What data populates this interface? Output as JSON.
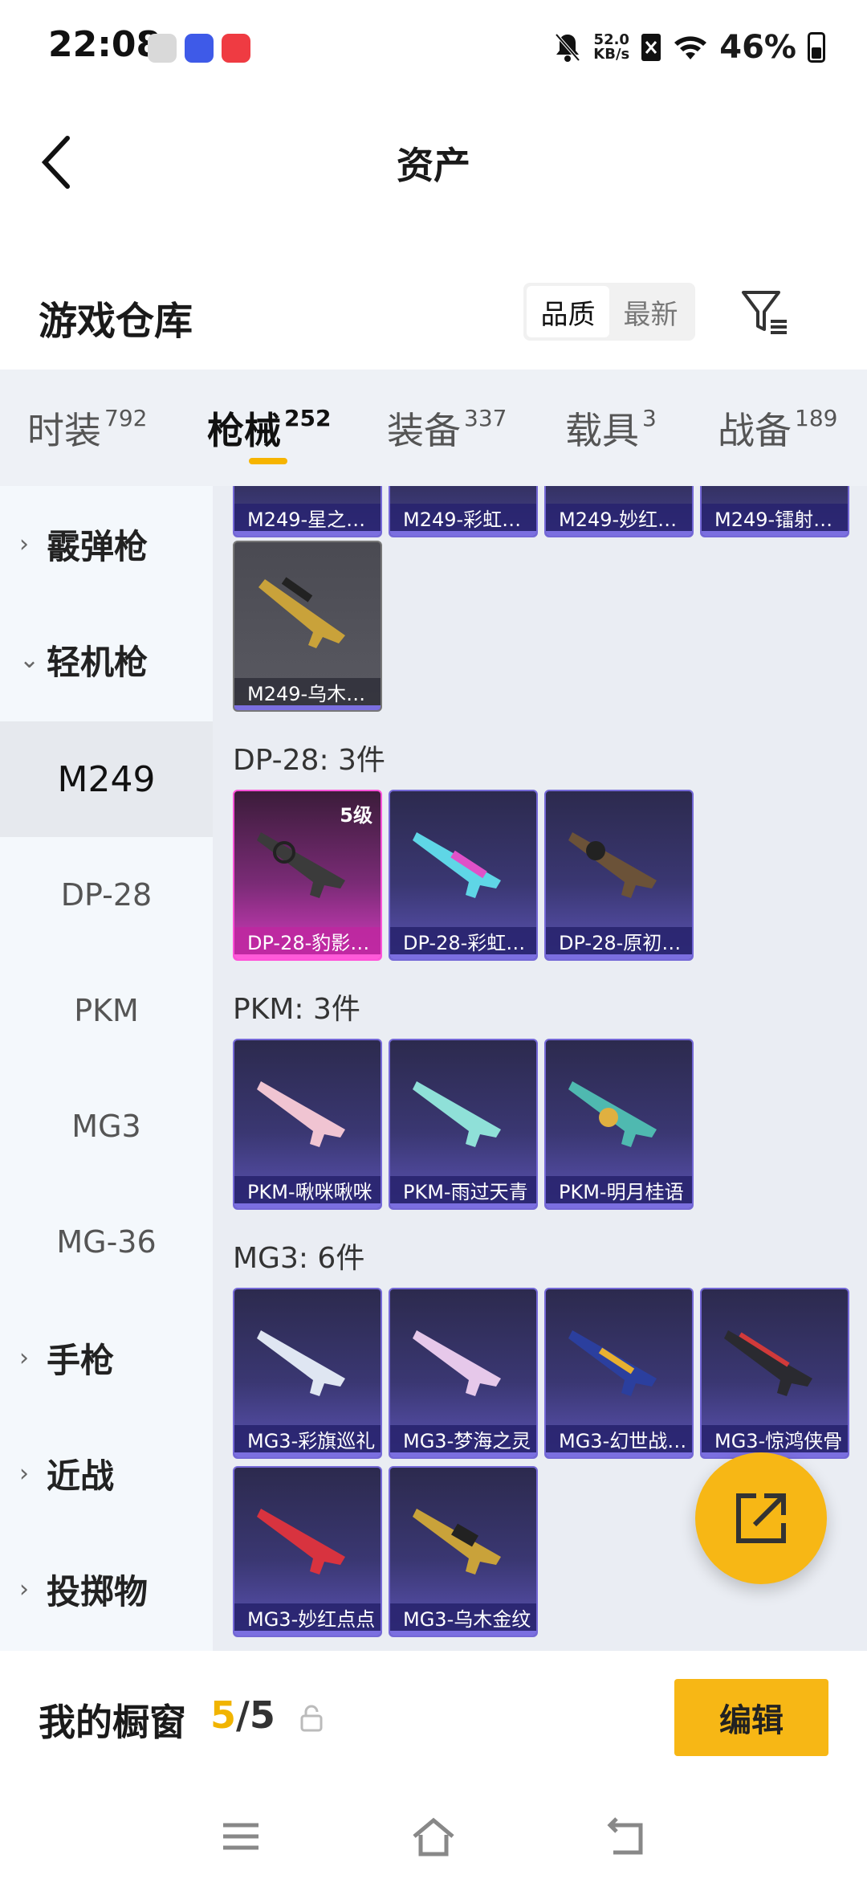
{
  "status": {
    "time": "22:08",
    "netspeed_top": "52.0",
    "netspeed_bottom": "KB/s",
    "battery": "46%"
  },
  "nav": {
    "title": "资产"
  },
  "warehouse": {
    "title": "游戏仓库",
    "sort_quality": "品质",
    "sort_newest": "最新"
  },
  "tabs": [
    {
      "label": "时装",
      "count": "792"
    },
    {
      "label": "枪械",
      "count": "252"
    },
    {
      "label": "装备",
      "count": "337"
    },
    {
      "label": "载具",
      "count": "3"
    },
    {
      "label": "战备",
      "count": "189"
    }
  ],
  "sidebar": {
    "shotgun": "霰弹枪",
    "lmg": "轻机枪",
    "subs": [
      "M249",
      "DP-28",
      "PKM",
      "MG3",
      "MG-36"
    ],
    "pistol": "手枪",
    "melee": "近战",
    "throwable": "投掷物"
  },
  "groups": {
    "m249_top": [
      "M249-星之…",
      "M249-彩虹…",
      "M249-妙红…",
      "M249-镭射…"
    ],
    "m249_extra": "M249-乌木…",
    "dp28_header": "DP-28: 3件",
    "dp28": [
      "DP-28-豹影…",
      "DP-28-彩虹…",
      "DP-28-原初…"
    ],
    "dp28_level": "5级",
    "pkm_header": "PKM: 3件",
    "pkm": [
      "PKM-啾咪啾咪",
      "PKM-雨过天青",
      "PKM-明月桂语"
    ],
    "mg3_header": "MG3: 6件",
    "mg3": [
      "MG3-彩旗巡礼",
      "MG3-梦海之灵",
      "MG3-幻世战…",
      "MG3-惊鸿侠骨",
      "MG3-妙红点点",
      "MG3-乌木金纹"
    ]
  },
  "showcase": {
    "title": "我的橱窗",
    "current": "5",
    "total": "/5",
    "edit": "编辑"
  }
}
